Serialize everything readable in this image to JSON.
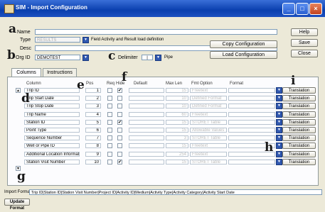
{
  "window": {
    "title": "SIM - Import Configuration"
  },
  "form": {
    "name_label": "Name",
    "name_value": "",
    "type_label": "Type",
    "type_value": "RESULTS",
    "type_desc": "Field Activity and Result load definition",
    "desc_label": "Desc",
    "org_label": "Org ID",
    "org_value": "DEMOTEST",
    "delimiter_label": "Delimiter",
    "delimiter_value": "|",
    "delimiter_name": "Pipe"
  },
  "buttons": {
    "help": "Help",
    "save": "Save",
    "close": "Close",
    "copy": "Copy Configuration",
    "load": "Load Configuration",
    "translation": "Translation",
    "update_format": "Update Format"
  },
  "tabs": [
    {
      "label": "Columns"
    },
    {
      "label": "Instructions"
    }
  ],
  "table": {
    "headers": {
      "column": "Column",
      "pos": "Pos",
      "req": "Req",
      "hide": "Hide",
      "default": "Default",
      "maxlen": "Max Len",
      "fmt_option": "Fmt Option",
      "format": "Format"
    },
    "rows": [
      {
        "column": "Trip ID",
        "pos": "1",
        "hide": true,
        "maxlen": "15",
        "fmt": "Freetext"
      },
      {
        "column": "Trip Start Date",
        "pos": "2",
        "hide": false,
        "maxlen": "10",
        "fmt": "Defined Format"
      },
      {
        "column": "Trip Stop Date",
        "pos": "3",
        "hide": false,
        "maxlen": "10",
        "fmt": "Defined Format"
      },
      {
        "column": "Trip Name",
        "pos": "4",
        "hide": false,
        "maxlen": "60",
        "fmt": "Freetext"
      },
      {
        "column": "Station ID",
        "pos": "5",
        "hide": true,
        "maxlen": "15",
        "fmt": "STORET Table"
      },
      {
        "column": "Point Type",
        "pos": "6",
        "hide": false,
        "maxlen": "15",
        "fmt": "Allowable Values"
      },
      {
        "column": "Sequence Number",
        "pos": "7",
        "hide": false,
        "maxlen": "3",
        "fmt": "STORET Table"
      },
      {
        "column": "Well or Pipe ID",
        "pos": "8",
        "hide": false,
        "maxlen": "15",
        "fmt": "Freetext"
      },
      {
        "column": "Additional Location Information",
        "pos": "9",
        "hide": false,
        "maxlen": "254",
        "fmt": "Freetext"
      },
      {
        "column": "Station Visit Number",
        "pos": "10",
        "hide": true,
        "maxlen": "15",
        "fmt": "STORET Table"
      }
    ]
  },
  "footer": {
    "import_format_label": "Import Format",
    "import_format_value": "Trip ID|Station ID|Station Visit Number|Project ID|Activity ID|Medium|Activity Type|Activity Category|Activity Start Date"
  },
  "annotations": {
    "a": "a",
    "b": "b",
    "c": "c",
    "d": "d",
    "e": "e",
    "f": "f",
    "g": "g",
    "h": "h",
    "i": "i"
  }
}
